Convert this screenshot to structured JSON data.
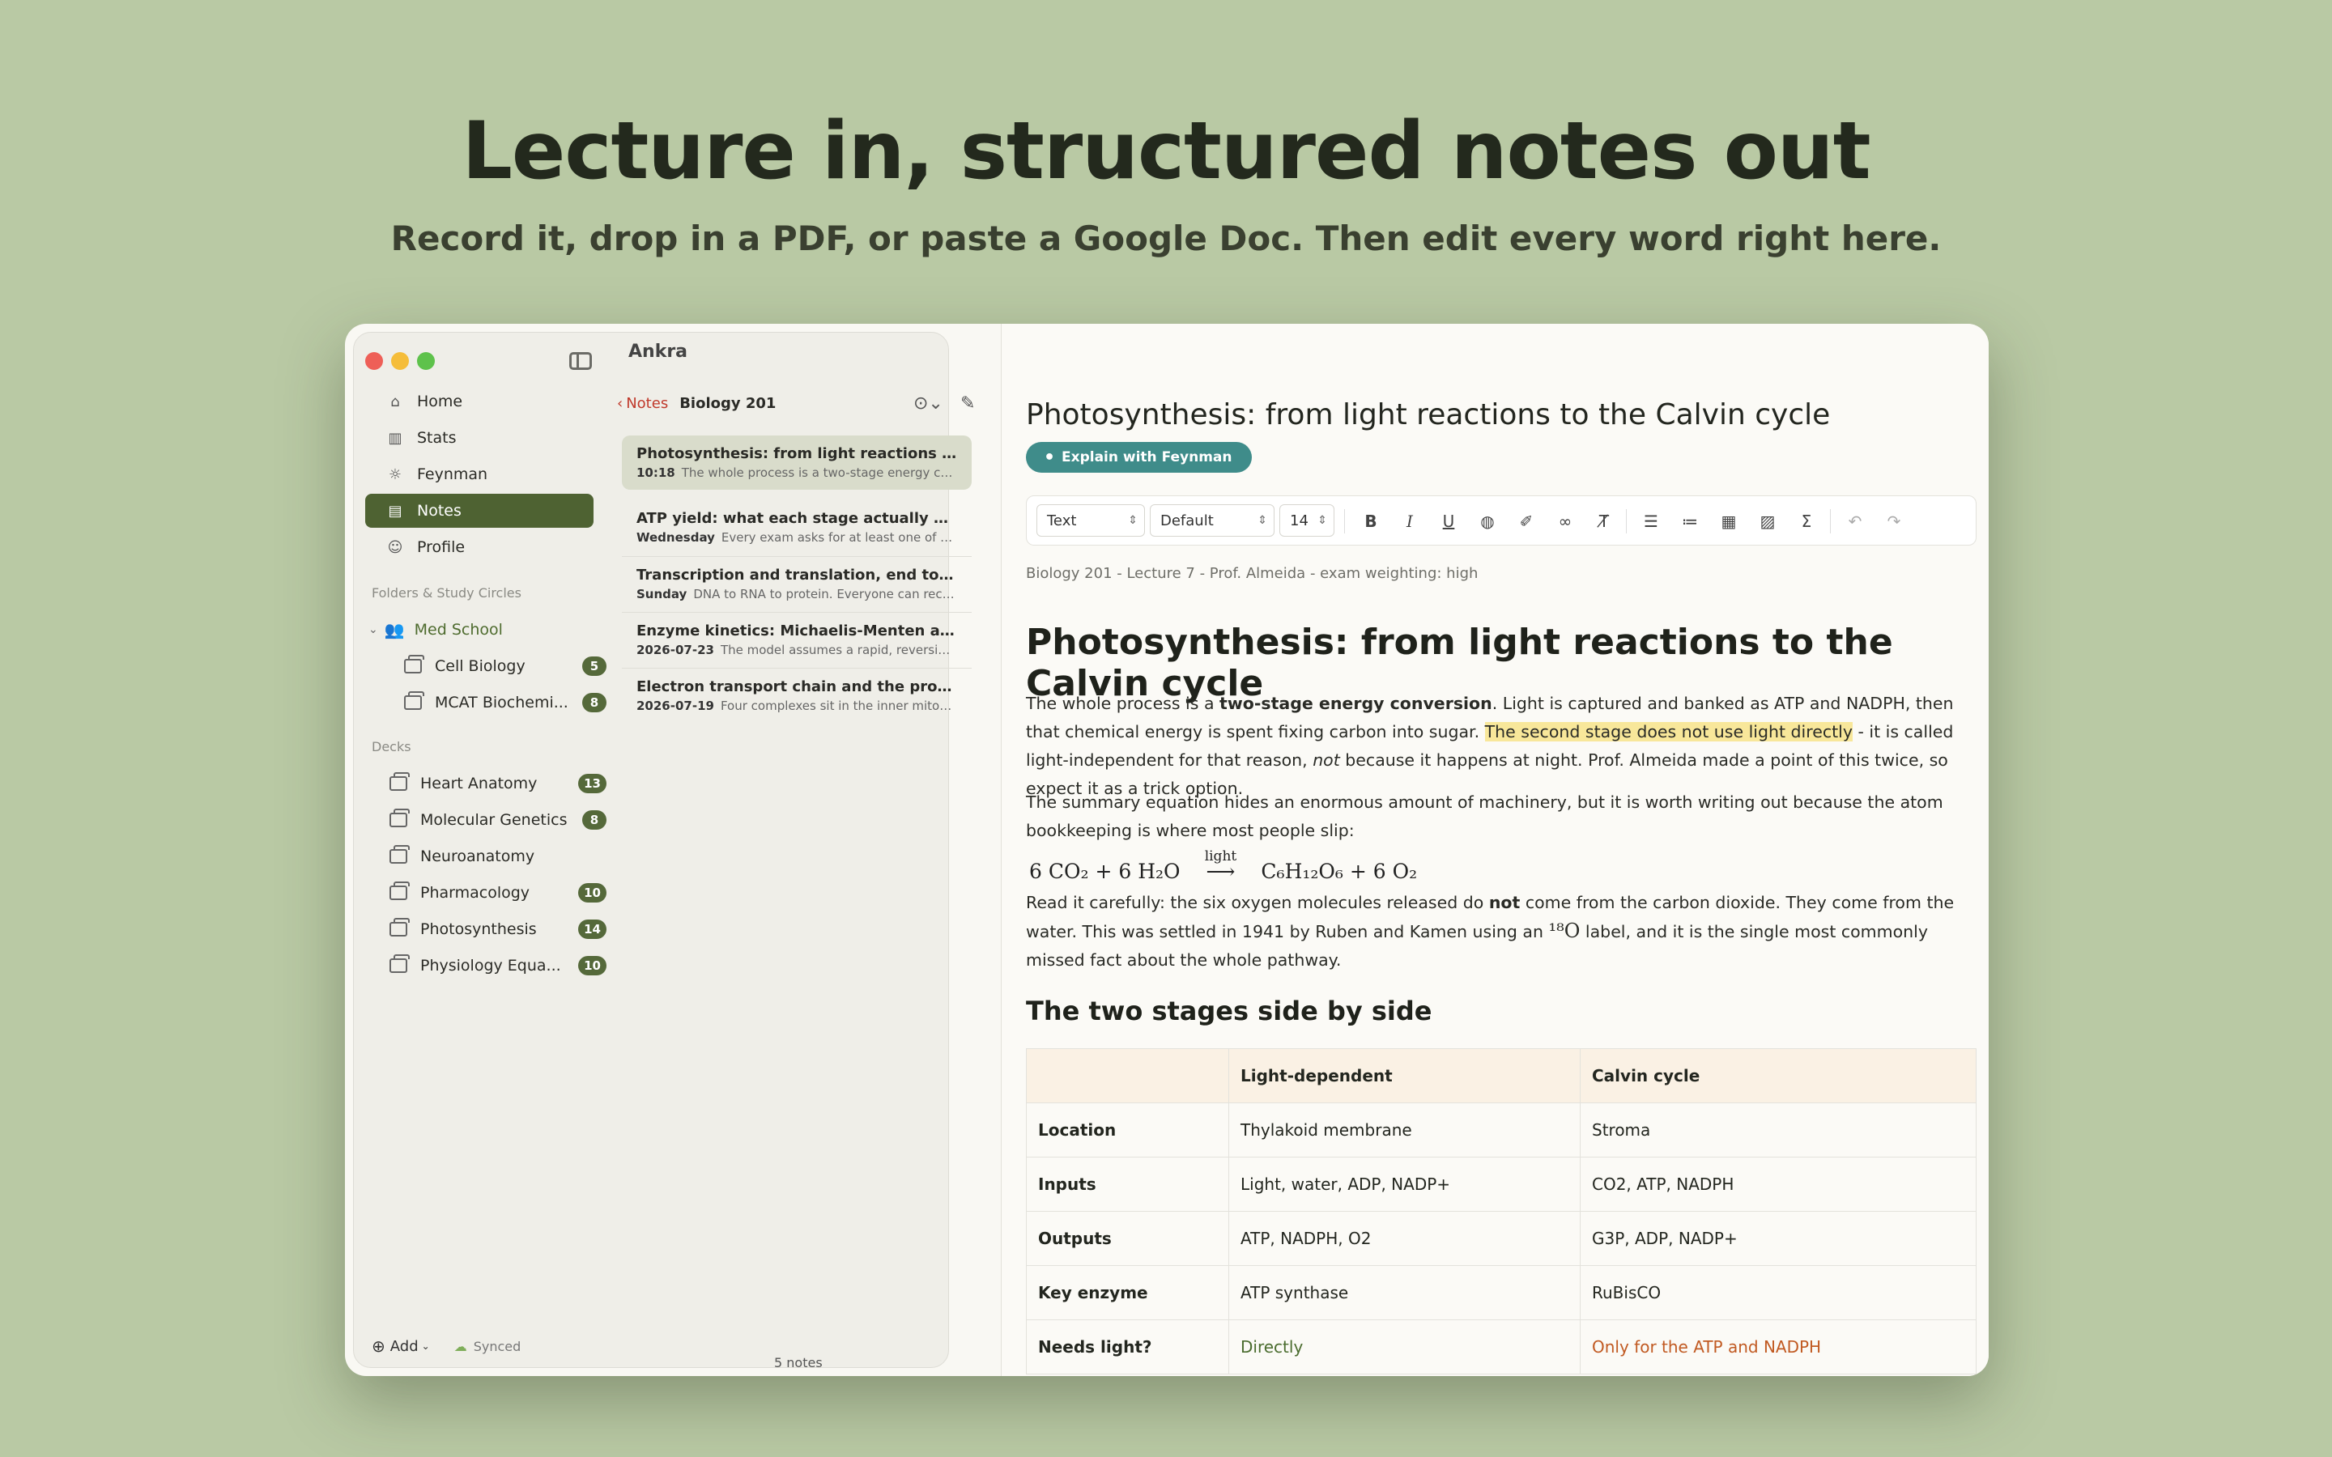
{
  "hero": {
    "title": "Lecture in, structured notes out",
    "subtitle": "Record it, drop in a PDF, or paste a Google Doc. Then edit every word right here."
  },
  "sidebar": {
    "nav": [
      {
        "label": "Home",
        "icon": "home-icon"
      },
      {
        "label": "Stats",
        "icon": "stats-icon"
      },
      {
        "label": "Feynman",
        "icon": "bulb-icon"
      },
      {
        "label": "Notes",
        "icon": "notes-icon"
      },
      {
        "label": "Profile",
        "icon": "profile-icon"
      }
    ],
    "folders_label": "Folders & Study Circles",
    "group": "Med School",
    "folders": [
      {
        "label": "Cell Biology",
        "count": "5"
      },
      {
        "label": "MCAT Biochemi...",
        "count": "8"
      }
    ],
    "decks_label": "Decks",
    "decks": [
      {
        "label": "Heart Anatomy",
        "count": "13"
      },
      {
        "label": "Molecular Genetics",
        "count": "8"
      },
      {
        "label": "Neuroanatomy",
        "count": ""
      },
      {
        "label": "Pharmacology",
        "count": "10"
      },
      {
        "label": "Photosynthesis",
        "count": "14"
      },
      {
        "label": "Physiology Equa...",
        "count": "10"
      }
    ],
    "add_label": "Add",
    "sync_label": "Synced"
  },
  "notelist": {
    "app_name": "Ankra",
    "back_label": "Notes",
    "folder": "Biology 201",
    "notes": [
      {
        "title": "Photosynthesis: from light reactions to the...",
        "time": "10:18",
        "preview": "The whole process is a two-stage energy con..."
      },
      {
        "title": "ATP yield: what each stage actually produc...",
        "time": "Wednesday",
        "preview": "Every exam asks for at least one of the..."
      },
      {
        "title": "Transcription and translation, end to end",
        "time": "Sunday",
        "preview": "DNA to RNA to protein. Everyone can recite..."
      },
      {
        "title": "Enzyme kinetics: Michaelis-Menten and in...",
        "time": "2026-07-23",
        "preview": "The model assumes a rapid, reversible..."
      },
      {
        "title": "Electron transport chain and the proton-m...",
        "time": "2026-07-19",
        "preview": "Four complexes sit in the inner mitoch..."
      }
    ],
    "count": "5 notes"
  },
  "editor": {
    "title": "Photosynthesis: from light reactions to the Calvin cycle",
    "feynman_label": "Explain with Feynman",
    "toolbar": {
      "style": "Text",
      "font": "Default",
      "size": "14"
    },
    "meta": "Biology 201 - Lecture 7 - Prof. Almeida - exam weighting: high",
    "heading": "Photosynthesis: from light reactions to the Calvin cycle",
    "p1": {
      "a": "The whole process is a ",
      "b": "two-stage energy conversion",
      "c": ". Light is captured and banked as ATP and NADPH, then that chemical energy is spent fixing carbon into sugar. ",
      "hl": "The second stage does not use light directly",
      "d": " - it is called light-independent for that reason, ",
      "e": "not",
      "f": " because it happens at night. Prof. Almeida made a point of this twice, so expect it as a trick option."
    },
    "p2": "The summary equation hides an enormous amount of machinery, but it is worth writing out because the atom bookkeeping is where most people slip:",
    "equation": {
      "left": "6 CO₂ + 6 H₂O",
      "arrow_label": "light",
      "right": "C₆H₁₂O₆ + 6 O₂"
    },
    "p3": {
      "a": "Read it carefully: the six oxygen molecules released do ",
      "b": "not",
      "c": " come from the carbon dioxide. They come from the water. This was settled in 1941 by Ruben and Kamen using an ",
      "iso": "¹⁸O",
      "d": " label, and it is the single most commonly missed fact about the whole pathway."
    },
    "h2": "The two stages side by side",
    "table": {
      "headers": [
        "",
        "Light-dependent",
        "Calvin cycle"
      ],
      "rows": [
        [
          "Location",
          "Thylakoid membrane",
          "Stroma"
        ],
        [
          "Inputs",
          "Light, water, ADP, NADP+",
          "CO2, ATP, NADPH"
        ],
        [
          "Outputs",
          "ATP, NADPH, O2",
          "G3P, ADP, NADP+"
        ],
        [
          "Key enzyme",
          "ATP synthase",
          "RuBisCO"
        ],
        [
          "Needs light?",
          "Directly",
          "Only for the ATP and NADPH"
        ]
      ]
    }
  },
  "colors": {
    "accent": "#4e6232",
    "feynman": "#3f8c8a",
    "highlight": "#f8e79a",
    "back_link": "#c0392b"
  }
}
